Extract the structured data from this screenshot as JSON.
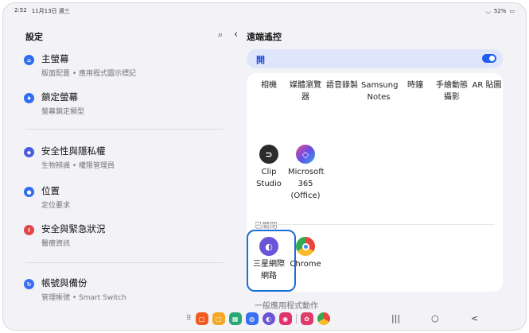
{
  "status": {
    "time": "2:52",
    "date": "11月13日 週三",
    "battery": "52%"
  },
  "left": {
    "title": "設定",
    "items": [
      {
        "title": "主螢幕",
        "sub": "版面配置 • 應用程式圖示標記",
        "icon": "home-icon",
        "color": "#2f6df0"
      },
      {
        "title": "鎖定螢幕",
        "sub": "螢幕鎖定類型",
        "icon": "lock-icon",
        "color": "#2f6df0"
      },
      {
        "title": "安全性與隱私權",
        "sub": "生物辨識 • 權限管理員",
        "icon": "shield-icon",
        "color": "#4b5be0"
      },
      {
        "title": "位置",
        "sub": "定位要求",
        "icon": "location-icon",
        "color": "#2f6df0"
      },
      {
        "title": "安全與緊急狀況",
        "sub": "醫療資訊",
        "icon": "emergency-icon",
        "color": "#e04848"
      },
      {
        "title": "帳號與備份",
        "sub": "管理帳號 • Smart Switch",
        "icon": "sync-icon",
        "color": "#3b6ff0"
      }
    ]
  },
  "right": {
    "title": "遠端遙控",
    "toggle_label": "開",
    "apps_row1": [
      "相機",
      "媒體瀏覽器",
      "語音錄製",
      "Samsung Notes",
      "時鐘",
      "手繪動態攝影",
      "AR 貼圖"
    ],
    "apps_row2": [
      "Clip Studio",
      "Microsoft 365 (Office)"
    ],
    "closed_label": "已關閉",
    "apps_closed": [
      "三星網際網路",
      "Chrome"
    ],
    "general_label": "一般應用程式動作"
  },
  "nav": {
    "apps": "⠿",
    "recents": "|||",
    "home": "○",
    "back": "<"
  }
}
